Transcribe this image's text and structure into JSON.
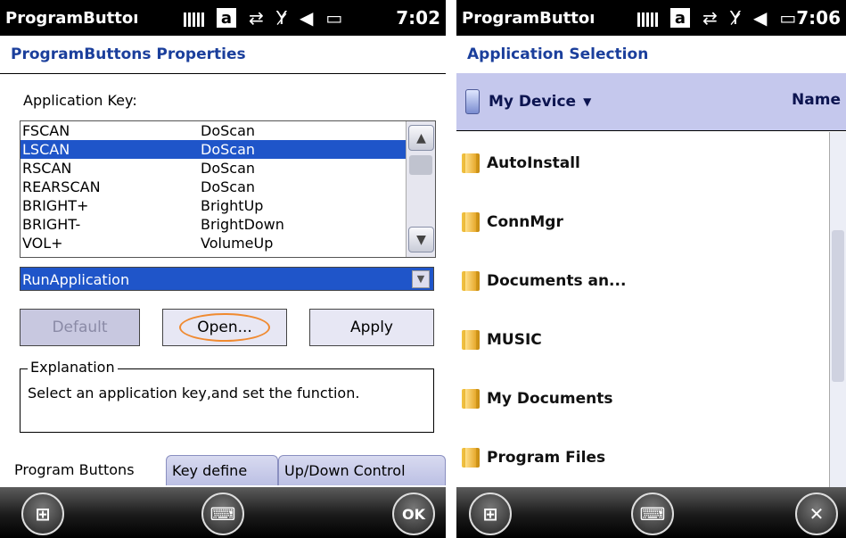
{
  "left": {
    "status": {
      "title": "ProgramButtoı",
      "a_label": "a",
      "time": "7:02"
    },
    "page_title": "ProgramButtons Properties",
    "app_key_label": "Application Key:",
    "keys": [
      {
        "key": "FSCAN",
        "func": "DoScan"
      },
      {
        "key": "LSCAN",
        "func": "DoScan"
      },
      {
        "key": "RSCAN",
        "func": "DoScan"
      },
      {
        "key": "REARSCAN",
        "func": "DoScan"
      },
      {
        "key": "BRIGHT+",
        "func": "BrightUp"
      },
      {
        "key": "BRIGHT-",
        "func": "BrightDown"
      },
      {
        "key": "VOL+",
        "func": "VolumeUp"
      }
    ],
    "dropdown_value": "RunApplication",
    "buttons": {
      "default": "Default",
      "open": "Open...",
      "apply": "Apply"
    },
    "explanation_legend": "Explanation",
    "explanation_text": "Select an application key,and set the function.",
    "tabs": [
      "Program Buttons",
      "Key define",
      "Up/Down Control"
    ],
    "soft_ok": "OK"
  },
  "right": {
    "status": {
      "title": "ProgramButtoı",
      "a_label": "a",
      "time": "7:06"
    },
    "page_title": "Application Selection",
    "location": "My Device",
    "sort_by": "Name",
    "folders": [
      "AutoInstall",
      "ConnMgr",
      "Documents an...",
      "MUSIC",
      "My Documents",
      "Program Files"
    ]
  },
  "colors": {
    "accent_blue": "#1f55c9",
    "title_blue": "#1b3f9c",
    "header_lavender": "#c5c8ed",
    "highlight_orange": "#f08a30"
  }
}
